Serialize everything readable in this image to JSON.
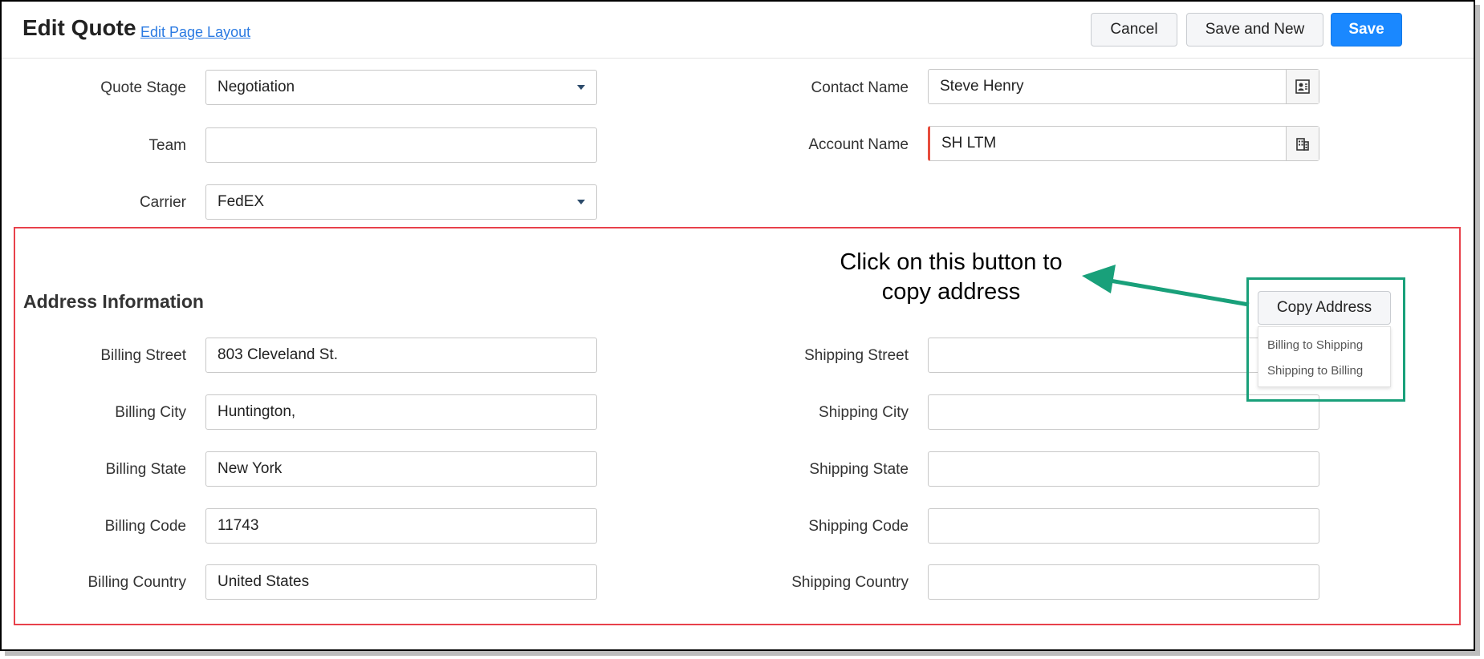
{
  "header": {
    "title": "Edit Quote",
    "edit_layout_link": "Edit Page Layout",
    "cancel_label": "Cancel",
    "save_new_label": "Save and New",
    "save_label": "Save"
  },
  "top_fields": {
    "quote_stage": {
      "label": "Quote Stage",
      "value": "Negotiation"
    },
    "team": {
      "label": "Team",
      "value": ""
    },
    "carrier": {
      "label": "Carrier",
      "value": "FedEX"
    },
    "contact_name": {
      "label": "Contact Name",
      "value": "Steve Henry",
      "icon": "contact-card-icon"
    },
    "account_name": {
      "label": "Account Name",
      "value": "SH LTM",
      "icon": "building-icon"
    }
  },
  "address": {
    "section_title": "Address Information",
    "billing_street": {
      "label": "Billing Street",
      "value": "803 Cleveland St."
    },
    "billing_city": {
      "label": "Billing City",
      "value": "Huntington,"
    },
    "billing_state": {
      "label": "Billing State",
      "value": "New York"
    },
    "billing_code": {
      "label": "Billing Code",
      "value": "11743"
    },
    "billing_country": {
      "label": "Billing Country",
      "value": "United States"
    },
    "shipping_street": {
      "label": "Shipping Street",
      "value": ""
    },
    "shipping_city": {
      "label": "Shipping City",
      "value": ""
    },
    "shipping_state": {
      "label": "Shipping State",
      "value": ""
    },
    "shipping_code": {
      "label": "Shipping Code",
      "value": ""
    },
    "shipping_country": {
      "label": "Shipping Country",
      "value": ""
    }
  },
  "copy_address": {
    "button_label": "Copy Address",
    "options": [
      "Billing to Shipping",
      "Shipping to Billing"
    ]
  },
  "annotation": {
    "line1": "Click on this button to",
    "line2": "copy address"
  },
  "colors": {
    "primary": "#1a88ff",
    "highlight_red": "#e8414b",
    "highlight_green": "#19a07a",
    "link": "#2a7ae2"
  }
}
